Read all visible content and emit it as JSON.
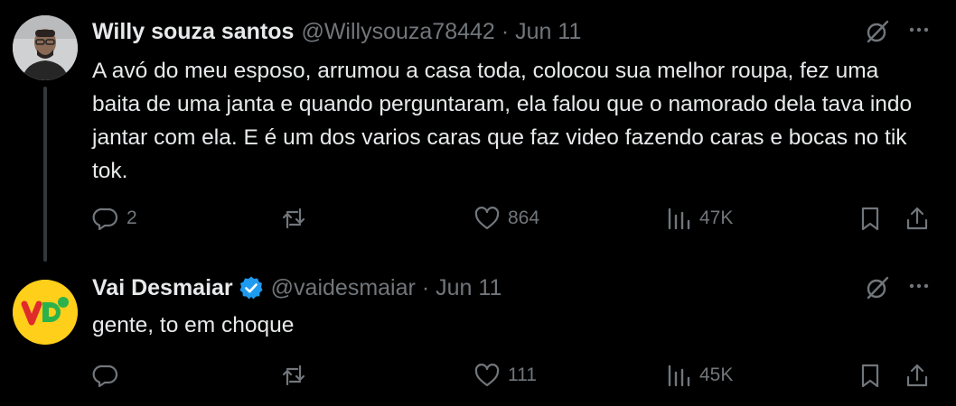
{
  "tweets": [
    {
      "author_name": "Willy souza santos",
      "handle": "@Willysouza78442",
      "separator": "·",
      "date": "Jun 11",
      "text": "A avó do meu esposo, arrumou a casa toda, colocou sua melhor roupa, fez uma baita de uma janta e quando perguntaram, ela falou que o namorado dela tava indo jantar com ela. E é um dos varios caras que faz video fazendo caras e bocas no tik tok.",
      "replies": "2",
      "retweets": "",
      "likes": "864",
      "views": "47K",
      "verified": false
    },
    {
      "author_name": "Vai Desmaiar",
      "handle": "@vaidesmaiar",
      "separator": "·",
      "date": "Jun 11",
      "text": "gente, to em choque",
      "replies": "",
      "retweets": "",
      "likes": "111",
      "views": "45K",
      "verified": true
    }
  ],
  "icons": {
    "reply": "reply-icon",
    "retweet": "retweet-icon",
    "like": "heart-icon",
    "views": "views-chart-icon",
    "bookmark": "bookmark-icon",
    "share": "share-icon",
    "grok": "grok-icon",
    "more": "more-icon",
    "verified": "verified-badge-icon"
  },
  "colors": {
    "background": "#000000",
    "text": "#e7e9ea",
    "muted": "#71767b",
    "verified": "#1d9bf0",
    "avatar2_bg": "#ffcf1a",
    "logo_red": "#e02b2b",
    "logo_green": "#2bb24c"
  }
}
